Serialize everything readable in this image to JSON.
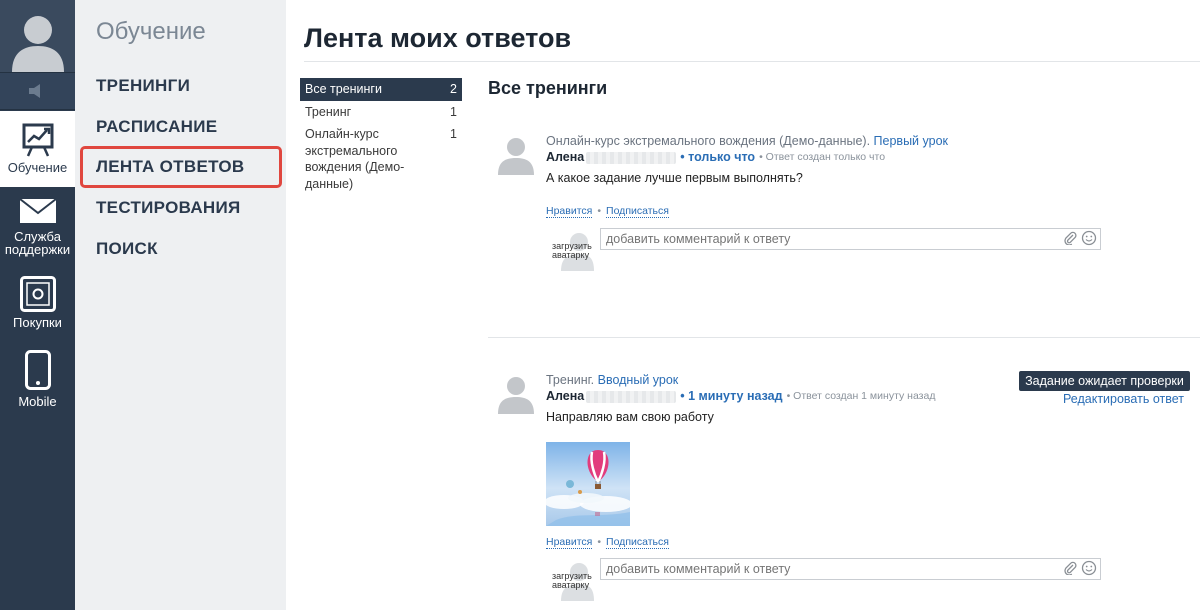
{
  "rail": {
    "items": [
      {
        "label": "Обучение",
        "icon": "chart-board-icon",
        "active": true
      },
      {
        "label1": "Служба",
        "label2": "поддержки",
        "icon": "envelope-icon"
      },
      {
        "label": "Покупки",
        "icon": "safe-icon"
      },
      {
        "label": "Mobile",
        "icon": "phone-icon"
      }
    ]
  },
  "subnav": {
    "title": "Обучение",
    "links": [
      "ТРЕНИНГИ",
      "РАСПИСАНИЕ",
      "ЛЕНТА ОТВЕТОВ",
      "ТЕСТИРОВАНИЯ",
      "ПОИСК"
    ]
  },
  "page": {
    "title": "Лента моих ответов",
    "section_title": "Все тренинги"
  },
  "filter": [
    {
      "label": "Все тренинги",
      "count": "2"
    },
    {
      "label": "Тренинг",
      "count": "1"
    },
    {
      "label": "Онлайн-курс экстремального вождения (Демо-данные)",
      "count": "1"
    }
  ],
  "posts": [
    {
      "course": "Онлайн-курс экстремального вождения (Демо-данные).",
      "lesson": "Первый урок",
      "author": "Алена",
      "when": "• только что",
      "created": "• Ответ создан только что",
      "text": "А какое задание лучше первым выполнять?",
      "like": "Нравится",
      "dot": "•",
      "subscribe": "Подписаться",
      "avatar_text1": "загрузить",
      "avatar_text2": "аватарку",
      "comment_placeholder": "добавить комментарий к ответу"
    },
    {
      "course": "Тренинг.",
      "lesson": "Вводный урок",
      "author": "Алена",
      "when": "• 1 минуту назад",
      "created": "• Ответ создан 1 минуту назад",
      "text": "Направляю вам свою работу",
      "like": "Нравится",
      "dot": "•",
      "subscribe": "Подписаться",
      "avatar_text1": "загрузить",
      "avatar_text2": "аватарку",
      "comment_placeholder": "добавить комментарий к ответу",
      "status_badge": "Задание ожидает проверки",
      "edit_label": "Редактировать ответ"
    }
  ],
  "colors": {
    "rail": "#2b3a4d",
    "subnav_bg": "#eef0f2",
    "link": "#2a6db5",
    "highlight": "#e0473f"
  }
}
